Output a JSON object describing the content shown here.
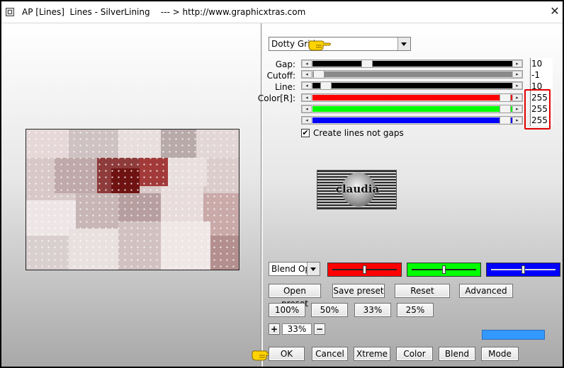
{
  "window": {
    "title": "AP [Lines]  Lines - SilverLining    --- > http://www.graphicxtras.com"
  },
  "preset_combo": {
    "value": "Dotty Grid"
  },
  "params": [
    {
      "label": "Gap:",
      "value": "10"
    },
    {
      "label": "Cutoff:",
      "value": "-1"
    },
    {
      "label": "Line:",
      "value": "10"
    },
    {
      "label": "Color[R]:",
      "value": "255"
    },
    {
      "label": "",
      "value": "255"
    },
    {
      "label": "",
      "value": "255"
    }
  ],
  "checkbox": {
    "label": "Create lines not gaps",
    "checked": true,
    "mark": "✔"
  },
  "logo_text": "claudia",
  "blend_combo": {
    "value": "Blend Optio"
  },
  "mini_sliders": [
    {
      "color": "#ff0000"
    },
    {
      "color": "#00ff00"
    },
    {
      "color": "#0000ff"
    }
  ],
  "buttons": {
    "open_preset": "Open preset",
    "save_preset": "Save preset",
    "reset": "Reset",
    "advanced": "Advanced",
    "zoom100": "100%",
    "zoom50": "50%",
    "zoom33": "33%",
    "zoom25": "25%",
    "zoom_in": "+",
    "zoom_out": "−",
    "zoom_value": "33%",
    "ok": "OK",
    "cancel": "Cancel",
    "xtreme": "Xtreme",
    "color": "Color",
    "blend": "Blend",
    "mode": "Mode"
  },
  "colors": {
    "red": "#ff0000",
    "green": "#00ff00",
    "blue": "#0000ff",
    "color_swatch": "#3399ff",
    "highlight_box": "#e00000"
  },
  "icons": [
    "app-icon",
    "close-icon",
    "pointing-hand-icon",
    "chevron-down-icon",
    "check-icon"
  ]
}
